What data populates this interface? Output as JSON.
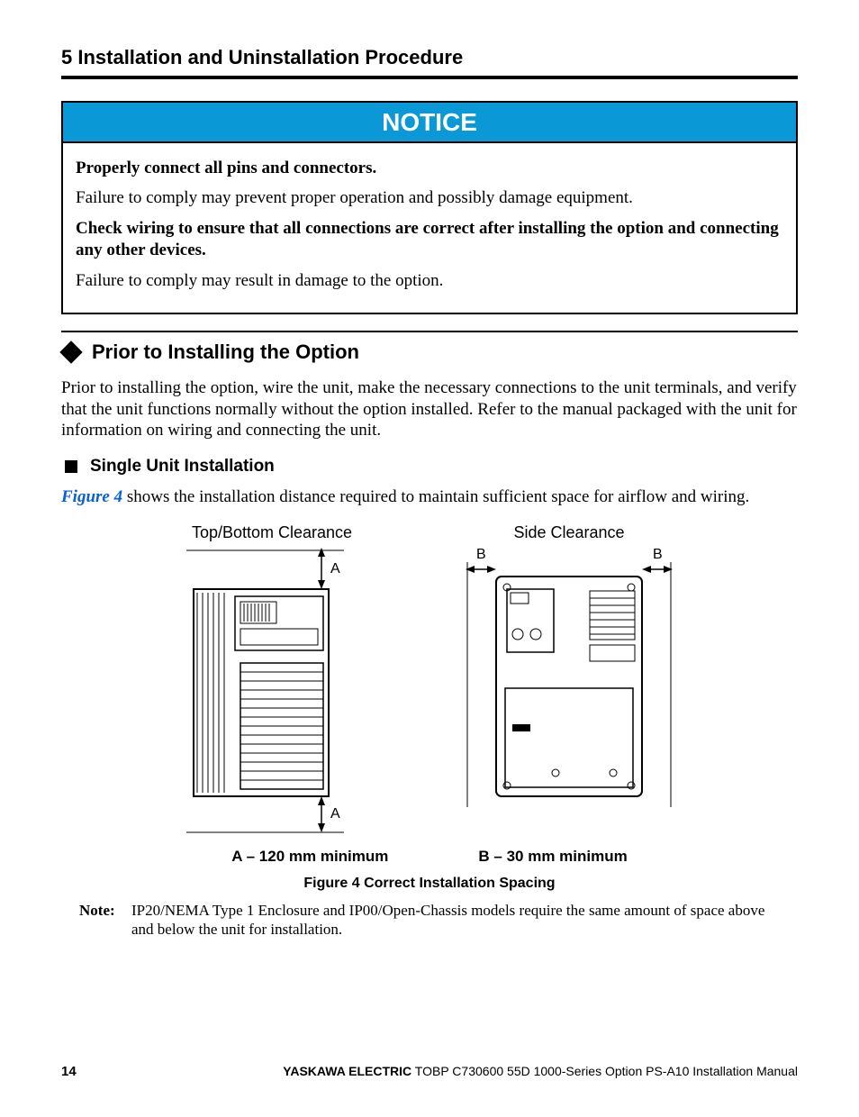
{
  "heading": "5  Installation and Uninstallation Procedure",
  "notice": {
    "title": "NOTICE",
    "p1_bold": "Properly connect all pins and connectors.",
    "p1_text": "Failure to comply may prevent proper operation and possibly damage equipment.",
    "p2_bold": "Check wiring to ensure that all connections are correct after installing the option and connecting any other devices.",
    "p2_text": "Failure to comply may result in damage to the option."
  },
  "subsection": {
    "title": "Prior to Installing the Option",
    "text": "Prior to installing the option, wire the unit, make the necessary connections to the unit terminals, and verify that the unit functions normally without the option installed. Refer to the manual packaged with the unit for information on wiring and connecting the unit."
  },
  "sub2": {
    "title": "Single Unit Installation",
    "figref": "Figure 4",
    "text_after": " shows the installation distance required to maintain sufficient space for airflow and wiring."
  },
  "figure": {
    "left_title": "Top/Bottom Clearance",
    "right_title": "Side Clearance",
    "label_A": "A",
    "label_B": "B",
    "legend_A": "A  –  120 mm minimum",
    "legend_B": "B  –  30 mm minimum",
    "caption": "Figure 4  Correct Installation Spacing"
  },
  "note": {
    "label": "Note:",
    "text": "IP20/NEMA Type 1 Enclosure and IP00/Open-Chassis models require the same amount of space above and below the unit for installation."
  },
  "footer": {
    "page": "14",
    "brand": "YASKAWA ELECTRIC",
    "doc": " TOBP C730600 55D 1000-Series Option PS-A10 Installation Manual"
  }
}
